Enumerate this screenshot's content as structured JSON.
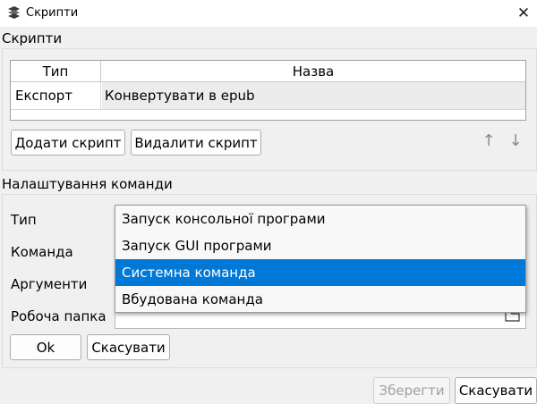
{
  "window": {
    "title": "Скрипти",
    "close_glyph": "✕"
  },
  "scripts": {
    "section_title": "Скрипти",
    "table": {
      "headers": [
        "Тип",
        "Назва"
      ],
      "rows": [
        {
          "type": "Експорт",
          "name": "Конвертувати в epub"
        }
      ]
    },
    "add_button": "Додати скрипт",
    "remove_button": "Видалити скрипт",
    "move_up_glyph": "↑",
    "move_down_glyph": "↓"
  },
  "command": {
    "section_title": "Налаштування команди",
    "labels": {
      "type": "Тип",
      "command": "Команда",
      "arguments": "Аргументи",
      "working_dir": "Робоча папка"
    },
    "type_options": [
      "Запуск консольної програми",
      "Запуск GUI програми",
      "Системна команда",
      "Вбудована команда"
    ],
    "selected_option_index": 2,
    "ok_button": "Ok",
    "cancel_button": "Скасувати"
  },
  "footer": {
    "save_button": "Зберегти",
    "cancel_button": "Скасувати"
  },
  "icons": {
    "app": "stack-icon",
    "folder": "folder-icon"
  },
  "colors": {
    "selection": "#0078d7"
  }
}
